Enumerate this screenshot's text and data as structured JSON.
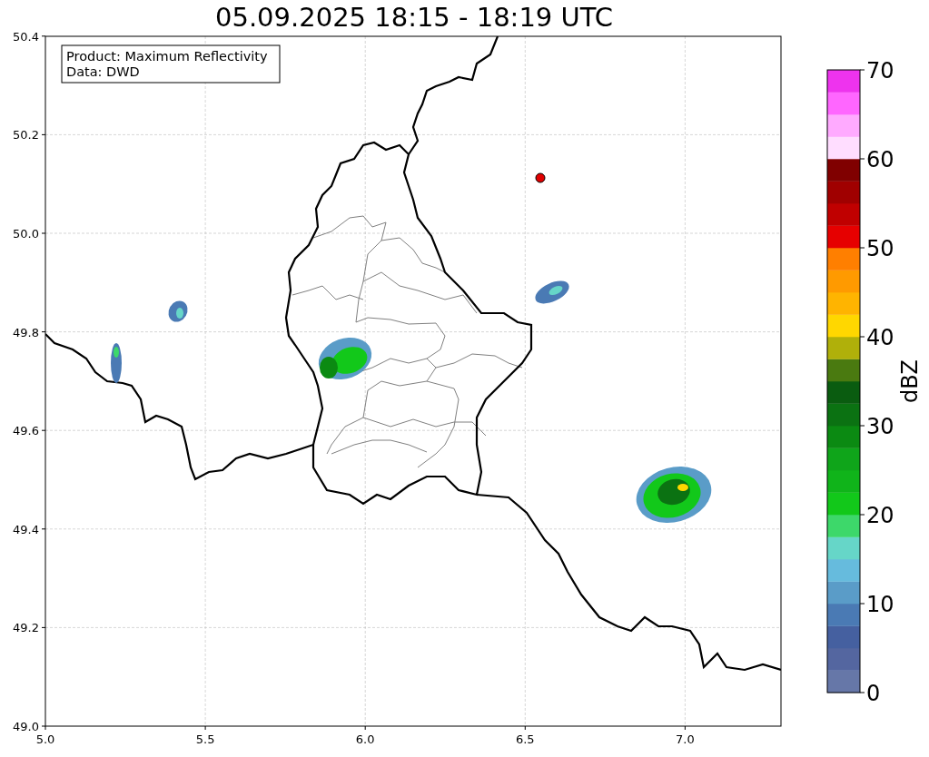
{
  "title": "05.09.2025 18:15 - 18:19 UTC",
  "info_box": [
    "Product: Maximum Reflectivity",
    "Data: DWD"
  ],
  "x_axis": {
    "ticks": [
      "5.0",
      "5.5",
      "6.0",
      "6.5",
      "7.0"
    ]
  },
  "y_axis": {
    "ticks": [
      "50.4",
      "50.2",
      "50.0",
      "49.8",
      "49.6",
      "49.4",
      "49.2",
      "49.0"
    ]
  },
  "colorbar": {
    "label": "dBZ",
    "ticks": [
      "70",
      "60",
      "50",
      "40",
      "30",
      "20",
      "10",
      "0"
    ],
    "segments": [
      {
        "color": "#6677a8"
      },
      {
        "color": "#5466a0"
      },
      {
        "color": "#4560a0"
      },
      {
        "color": "#4a7ab4"
      },
      {
        "color": "#5a9cc8"
      },
      {
        "color": "#66bbdd"
      },
      {
        "color": "#66d6c8"
      },
      {
        "color": "#3dd86a"
      },
      {
        "color": "#12c81a"
      },
      {
        "color": "#10b41a"
      },
      {
        "color": "#0fa51a"
      },
      {
        "color": "#0b8a12"
      },
      {
        "color": "#0b7212"
      },
      {
        "color": "#0a5c10"
      },
      {
        "color": "#4a7a10"
      },
      {
        "color": "#b0b00a"
      },
      {
        "color": "#ffd700"
      },
      {
        "color": "#ffb400"
      },
      {
        "color": "#ff9a00"
      },
      {
        "color": "#ff7f00"
      },
      {
        "color": "#e60000"
      },
      {
        "color": "#c00000"
      },
      {
        "color": "#a00000"
      },
      {
        "color": "#800000"
      },
      {
        "color": "#ffddff"
      },
      {
        "color": "#ffaaff"
      },
      {
        "color": "#ff66ff"
      },
      {
        "color": "#ee33ee"
      }
    ]
  }
}
